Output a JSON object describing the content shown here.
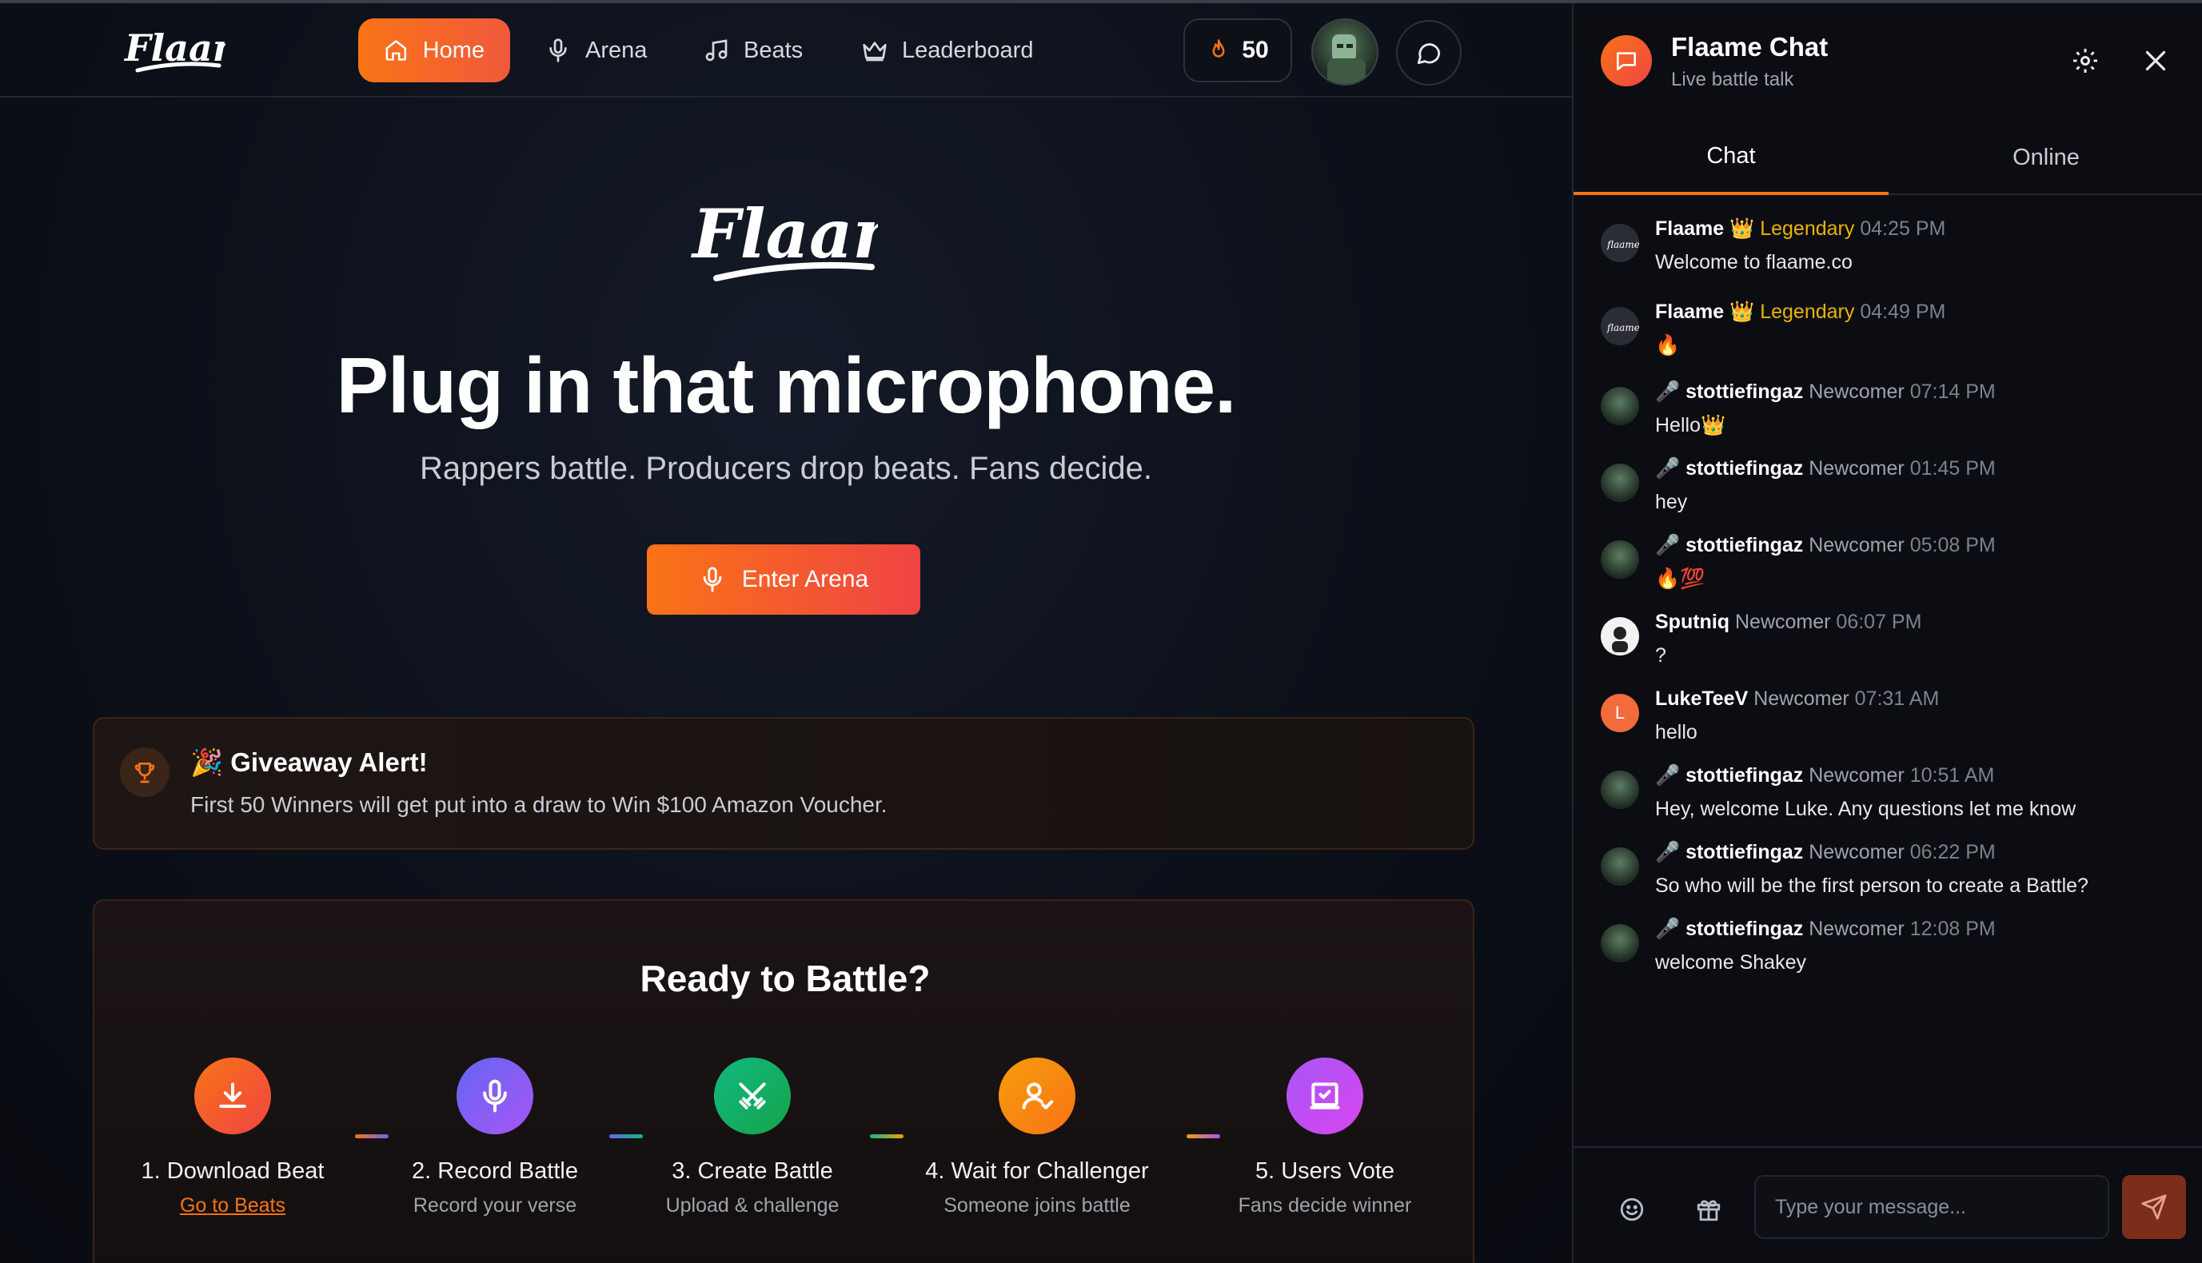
{
  "nav": {
    "logo": "Flaame",
    "items": [
      {
        "label": "Home",
        "icon": "home-icon",
        "active": true
      },
      {
        "label": "Arena",
        "icon": "microphone-icon"
      },
      {
        "label": "Beats",
        "icon": "music-note-icon"
      },
      {
        "label": "Leaderboard",
        "icon": "crown-icon"
      }
    ],
    "streak_count": "50",
    "streak_icon": "flame-icon",
    "chat_icon": "message-circle-icon"
  },
  "hero": {
    "logo": "Flaame",
    "title": "Plug in that microphone.",
    "subtitle": "Rappers battle. Producers drop beats. Fans decide.",
    "cta_label": "Enter Arena"
  },
  "giveaway": {
    "title": "🎉 Giveaway Alert!",
    "text": "First 50 Winners will get put into a draw to Win $100 Amazon Voucher."
  },
  "battle": {
    "title": "Ready to Battle?",
    "steps": [
      {
        "title": "1. Download Beat",
        "sub": "Go to Beats",
        "icon": "download-icon",
        "color_from": "#f97316",
        "color_to": "#ef4444"
      },
      {
        "title": "2. Record Battle",
        "sub": "Record your verse",
        "icon": "microphone-icon",
        "color_from": "#6366f1",
        "color_to": "#a855f7"
      },
      {
        "title": "3. Create Battle",
        "sub": "Upload & challenge",
        "icon": "swords-icon",
        "color_from": "#10b981",
        "color_to": "#16a34a"
      },
      {
        "title": "4. Wait for Challenger",
        "sub": "Someone joins battle",
        "icon": "user-check-icon",
        "color_from": "#f59e0b",
        "color_to": "#f97316"
      },
      {
        "title": "5. Users Vote",
        "sub": "Fans decide winner",
        "icon": "vote-icon",
        "color_from": "#a855f7",
        "color_to": "#d946ef"
      }
    ]
  },
  "chat": {
    "title": "Flaame Chat",
    "subtitle": "Live battle talk",
    "tabs": [
      "Chat",
      "Online"
    ],
    "messages": [
      {
        "user": "Flaame",
        "badge": "👑 Legendary",
        "time": "04:25 PM",
        "text": "Welcome to flaame.co",
        "avatar": "flaame"
      },
      {
        "user": "Flaame",
        "badge": "👑 Legendary",
        "time": "04:49 PM",
        "text": "🔥",
        "avatar": "flaame"
      },
      {
        "user": "🎤 stottiefingaz",
        "badge": "Newcomer",
        "time": "07:14 PM",
        "text": "Hello👑",
        "avatar": "stot"
      },
      {
        "user": "🎤 stottiefingaz",
        "badge": "Newcomer",
        "time": "01:45 PM",
        "text": "hey",
        "avatar": "stot"
      },
      {
        "user": "🎤 stottiefingaz",
        "badge": "Newcomer",
        "time": "05:08 PM",
        "text": "🔥💯",
        "avatar": "stot"
      },
      {
        "user": "Sputniq",
        "badge": "Newcomer",
        "time": "06:07 PM",
        "text": "?",
        "avatar": "sput"
      },
      {
        "user": "LukeTeeV",
        "badge": "Newcomer",
        "time": "07:31 AM",
        "text": "hello",
        "avatar": "luke",
        "initial": "L"
      },
      {
        "user": "🎤 stottiefingaz",
        "badge": "Newcomer",
        "time": "10:51 AM",
        "text": "Hey, welcome Luke. Any questions let me know",
        "avatar": "stot"
      },
      {
        "user": "🎤 stottiefingaz",
        "badge": "Newcomer",
        "time": "06:22 PM",
        "text": "So who will be the first person to create a Battle?",
        "avatar": "stot"
      },
      {
        "user": "🎤 stottiefingaz",
        "badge": "Newcomer",
        "time": "12:08 PM",
        "text": "welcome Shakey",
        "avatar": "stot"
      }
    ],
    "input_placeholder": "Type your message...",
    "input_value": ""
  },
  "colors": {
    "accent": "#f97316",
    "accent_red": "#ef4444",
    "legendary": "#eab308",
    "background": "#0a0c12"
  }
}
